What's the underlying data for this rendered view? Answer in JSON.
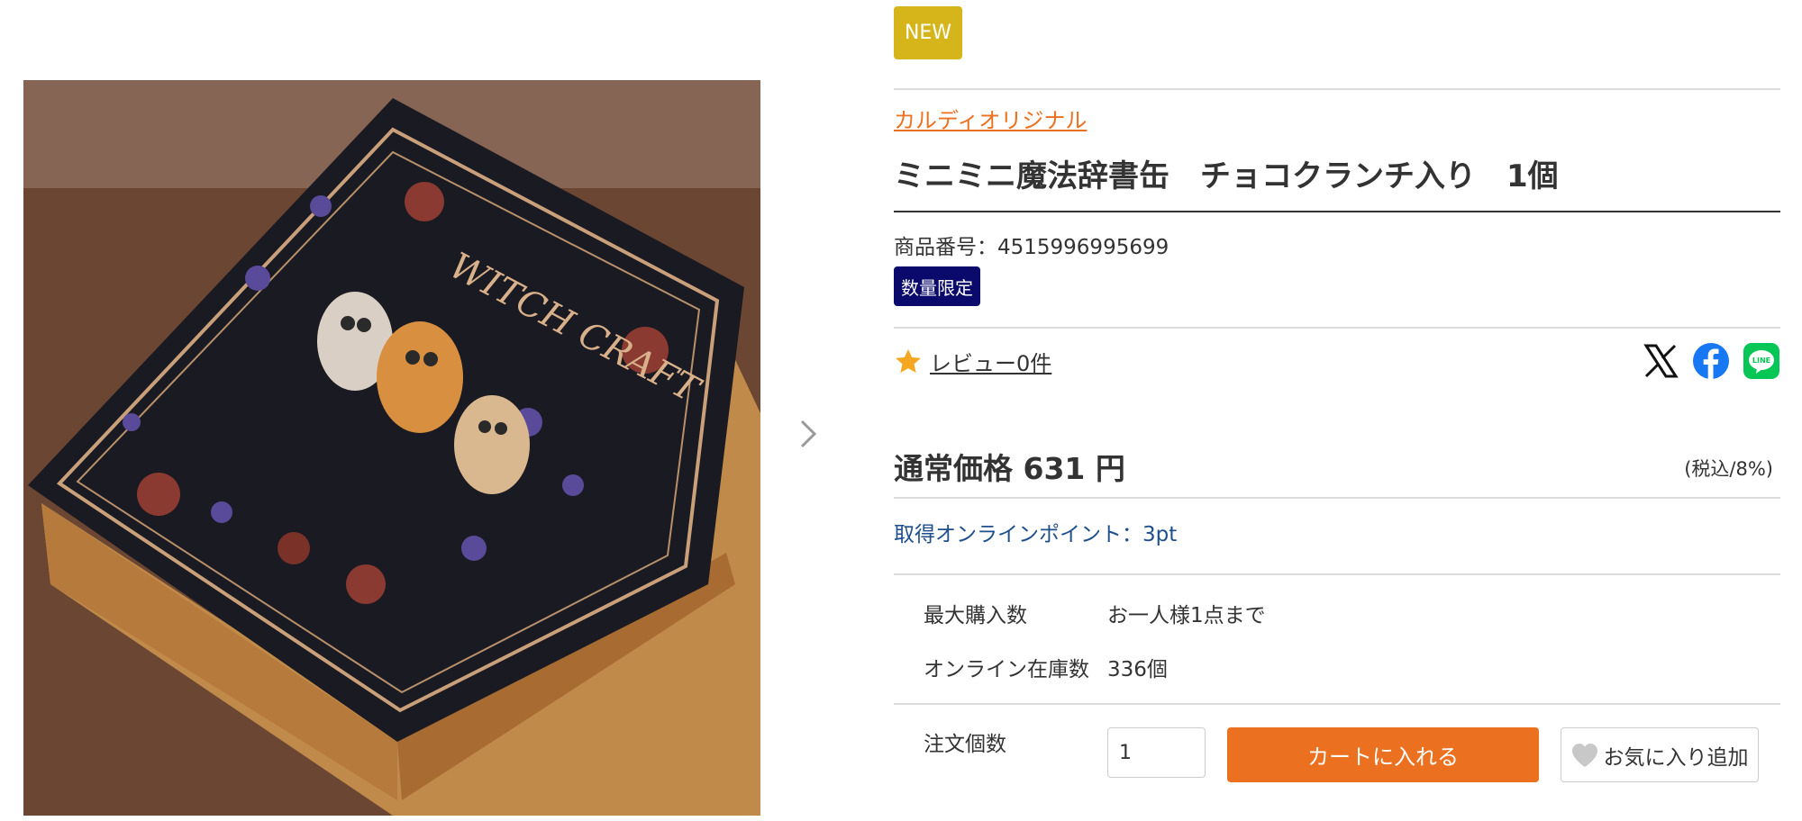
{
  "product": {
    "badge_new": "NEW",
    "brand_link": "カルディオリジナル",
    "title": "ミニミニ魔法辞書缶　チョコクランチ入り　1個",
    "sku_label": "商品番号：",
    "sku_value": "4515996995699",
    "limited_badge": "数量限定",
    "image_alt": "WITCH CRAFT"
  },
  "review": {
    "label": "レビュー0件",
    "icon": "star-icon"
  },
  "share": {
    "icons": [
      "x-icon",
      "facebook-icon",
      "line-icon"
    ]
  },
  "price": {
    "label": "通常価格",
    "amount": "631",
    "unit": "円",
    "tax_note": "(税込/8%)"
  },
  "points": {
    "label": "取得オンラインポイント：3pt"
  },
  "specs": {
    "max_label": "最大購入数",
    "max_value": "お一人様1点まで",
    "stock_label": "オンライン在庫数",
    "stock_value": "336個"
  },
  "order": {
    "qty_label": "注文個数",
    "qty_value": "1",
    "cart_button": "カートに入れる",
    "fav_button": "お気に入り追加"
  },
  "colors": {
    "accent_orange": "#eb7020",
    "new_badge": "#d5b51a",
    "limited_badge": "#0a0a6c",
    "points_text": "#1e4f8c",
    "star": "#f5a623"
  }
}
